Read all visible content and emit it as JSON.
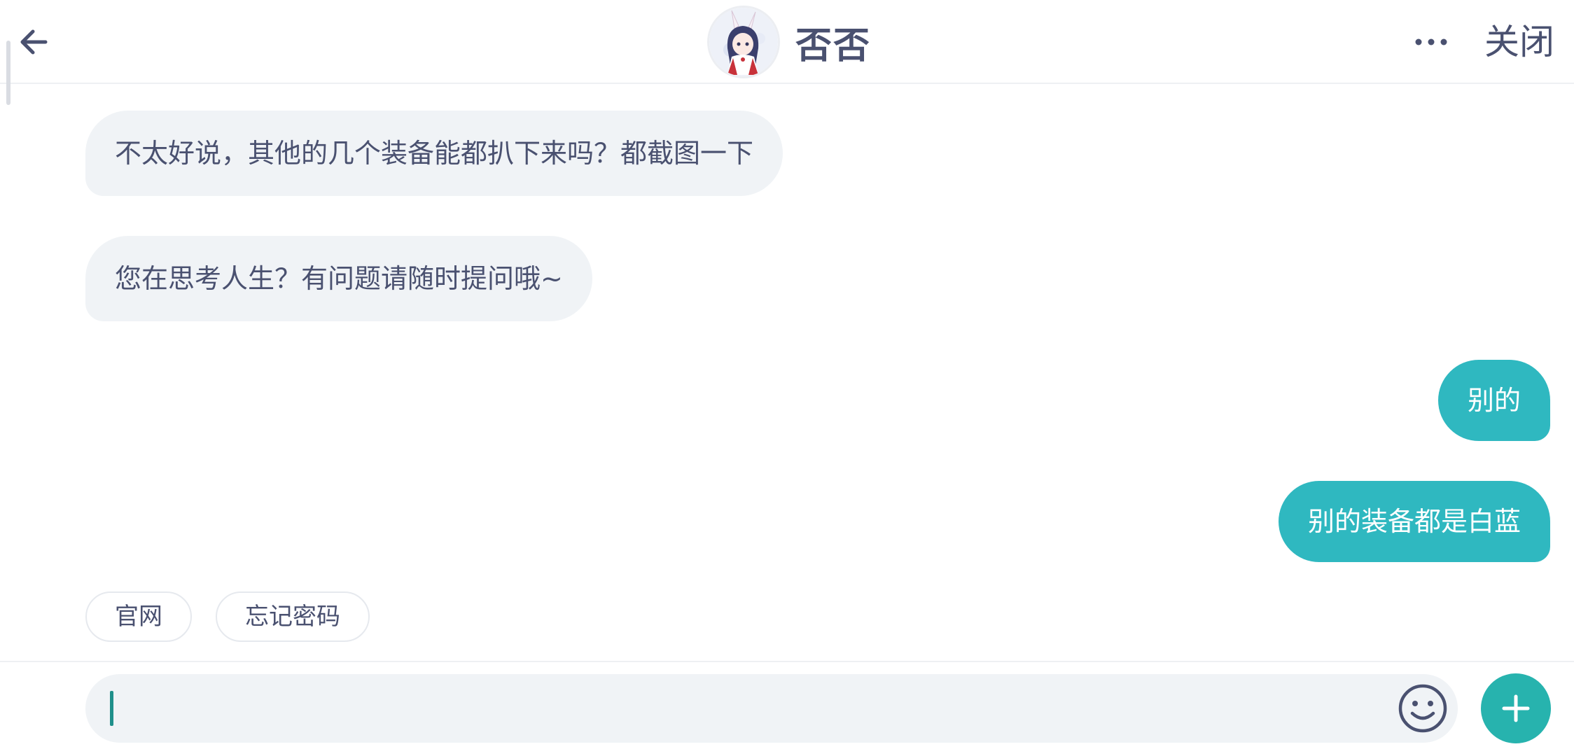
{
  "header": {
    "title": "否否",
    "close_label": "关闭",
    "back_icon": "arrow-left-icon",
    "more_icon": "ellipsis-icon"
  },
  "messages": [
    {
      "side": "left",
      "text": "不太好说，其他的几个装备能都扒下来吗？都截图一下"
    },
    {
      "side": "left",
      "text": "您在思考人生？有问题请随时提问哦~"
    },
    {
      "side": "right",
      "text": "别的"
    },
    {
      "side": "right",
      "text": "别的装备都是白蓝"
    }
  ],
  "quick_replies": [
    "官网",
    "忘记密码"
  ],
  "input": {
    "value": "",
    "emoji_icon": "smiley-icon",
    "plus_icon": "plus-icon"
  },
  "colors": {
    "accent": "#2fb8c0",
    "plus_button": "#27b3ae",
    "bubble_left_bg": "#f0f3f6",
    "text": "#4a5170"
  }
}
